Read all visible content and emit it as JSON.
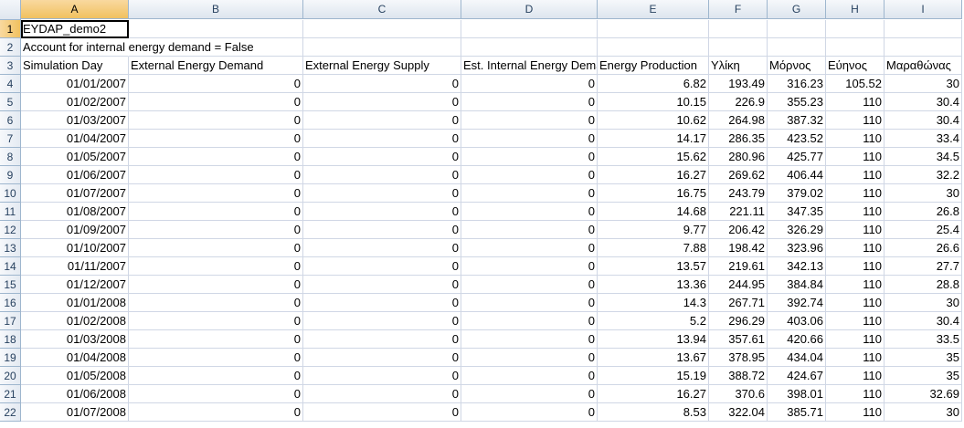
{
  "columns": [
    "A",
    "B",
    "C",
    "D",
    "E",
    "F",
    "G",
    "H",
    "I"
  ],
  "rows": [
    {
      "num": "1",
      "cells": [
        "EYDAP_demo2",
        "",
        "",
        "",
        "",
        "",
        "",
        "",
        ""
      ]
    },
    {
      "num": "2",
      "cells": [
        "Account for internal energy demand = False",
        "",
        "",
        "",
        "",
        "",
        "",
        "",
        ""
      ]
    },
    {
      "num": "3",
      "cells": [
        "Simulation Day",
        "External Energy Demand",
        "External Energy Supply",
        "Est. Internal Energy Demand",
        "Energy Production",
        "Υλίκη",
        "Μόρνος",
        "Εύηνος",
        "Μαραθώνας"
      ]
    },
    {
      "num": "4",
      "cells": [
        "01/01/2007",
        "0",
        "0",
        "0",
        "6.82",
        "193.49",
        "316.23",
        "105.52",
        "30"
      ]
    },
    {
      "num": "5",
      "cells": [
        "01/02/2007",
        "0",
        "0",
        "0",
        "10.15",
        "226.9",
        "355.23",
        "110",
        "30.4"
      ]
    },
    {
      "num": "6",
      "cells": [
        "01/03/2007",
        "0",
        "0",
        "0",
        "10.62",
        "264.98",
        "387.32",
        "110",
        "30.4"
      ]
    },
    {
      "num": "7",
      "cells": [
        "01/04/2007",
        "0",
        "0",
        "0",
        "14.17",
        "286.35",
        "423.52",
        "110",
        "33.4"
      ]
    },
    {
      "num": "8",
      "cells": [
        "01/05/2007",
        "0",
        "0",
        "0",
        "15.62",
        "280.96",
        "425.77",
        "110",
        "34.5"
      ]
    },
    {
      "num": "9",
      "cells": [
        "01/06/2007",
        "0",
        "0",
        "0",
        "16.27",
        "269.62",
        "406.44",
        "110",
        "32.2"
      ]
    },
    {
      "num": "10",
      "cells": [
        "01/07/2007",
        "0",
        "0",
        "0",
        "16.75",
        "243.79",
        "379.02",
        "110",
        "30"
      ]
    },
    {
      "num": "11",
      "cells": [
        "01/08/2007",
        "0",
        "0",
        "0",
        "14.68",
        "221.11",
        "347.35",
        "110",
        "26.8"
      ]
    },
    {
      "num": "12",
      "cells": [
        "01/09/2007",
        "0",
        "0",
        "0",
        "9.77",
        "206.42",
        "326.29",
        "110",
        "25.4"
      ]
    },
    {
      "num": "13",
      "cells": [
        "01/10/2007",
        "0",
        "0",
        "0",
        "7.88",
        "198.42",
        "323.96",
        "110",
        "26.6"
      ]
    },
    {
      "num": "14",
      "cells": [
        "01/11/2007",
        "0",
        "0",
        "0",
        "13.57",
        "219.61",
        "342.13",
        "110",
        "27.7"
      ]
    },
    {
      "num": "15",
      "cells": [
        "01/12/2007",
        "0",
        "0",
        "0",
        "13.36",
        "244.95",
        "384.84",
        "110",
        "28.8"
      ]
    },
    {
      "num": "16",
      "cells": [
        "01/01/2008",
        "0",
        "0",
        "0",
        "14.3",
        "267.71",
        "392.74",
        "110",
        "30"
      ]
    },
    {
      "num": "17",
      "cells": [
        "01/02/2008",
        "0",
        "0",
        "0",
        "5.2",
        "296.29",
        "403.06",
        "110",
        "30.4"
      ]
    },
    {
      "num": "18",
      "cells": [
        "01/03/2008",
        "0",
        "0",
        "0",
        "13.94",
        "357.61",
        "420.66",
        "110",
        "33.5"
      ]
    },
    {
      "num": "19",
      "cells": [
        "01/04/2008",
        "0",
        "0",
        "0",
        "13.67",
        "378.95",
        "434.04",
        "110",
        "35"
      ]
    },
    {
      "num": "20",
      "cells": [
        "01/05/2008",
        "0",
        "0",
        "0",
        "15.19",
        "388.72",
        "424.67",
        "110",
        "35"
      ]
    },
    {
      "num": "21",
      "cells": [
        "01/06/2008",
        "0",
        "0",
        "0",
        "16.27",
        "370.6",
        "398.01",
        "110",
        "32.69"
      ]
    },
    {
      "num": "22",
      "cells": [
        "01/07/2008",
        "0",
        "0",
        "0",
        "8.53",
        "322.04",
        "385.71",
        "110",
        "30"
      ]
    }
  ]
}
